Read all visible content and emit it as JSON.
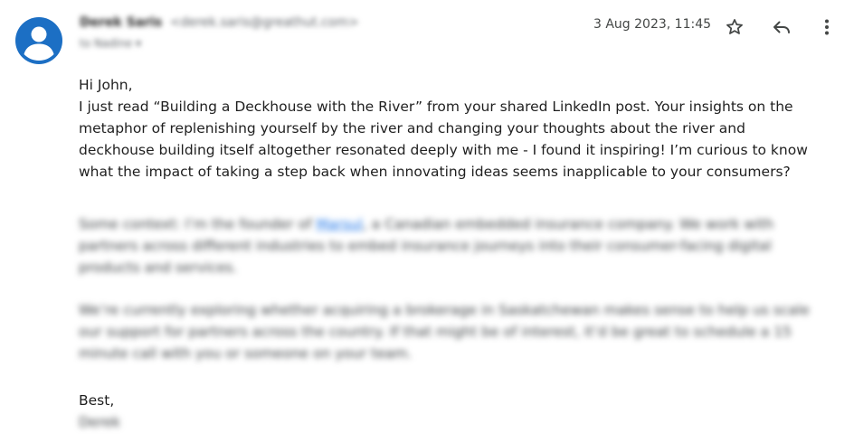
{
  "sender": {
    "name": "Derek Saris",
    "email": "<derek.saris@greathut.com>",
    "recipient_line": "to Nadine ▾"
  },
  "message": {
    "timestamp": "3 Aug 2023, 11:45",
    "greeting": "Hi John,",
    "paragraph1": "I just read “Building a Deckhouse with the River” from your shared LinkedIn post. Your insights on the metaphor of replenishing yourself by the river and changing your thoughts about the river and deckhouse building itself altogether resonated deeply with me - I found it inspiring! I’m curious to know what the impact of taking a step back when innovating ideas seems inapplicable to your consumers?",
    "context_before": "Some context: I’m the founder of ",
    "company_link": "Marsul",
    "context_after": ", a Canadian embedded insurance company. We work with partners across different industries to embed insurance journeys into their consumer-facing digital products and services.",
    "paragraph3": "We’re currently exploring whether acquiring a brokerage in Saskatchewan makes sense to help us scale our support for partners across the country. If that might be of interest, it’d be great to schedule a 15 minute call with you or someone on your team.",
    "closing": "Best,",
    "signature": "Derek"
  },
  "icons": {
    "avatar": "account-circle-icon",
    "star": "star-outline-icon",
    "reply": "reply-icon",
    "more": "more-vert-icon"
  },
  "colors": {
    "avatar_blue": "#1c6fc4",
    "link": "#1a73e8",
    "icon": "#444746"
  }
}
